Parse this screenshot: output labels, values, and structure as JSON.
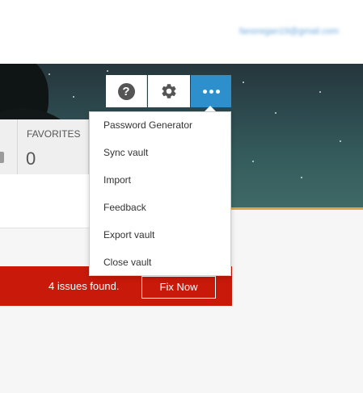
{
  "header": {
    "account_email": "fanoregan19@gmail.com"
  },
  "toolbar": {
    "help_icon": "question-circle-icon",
    "settings_icon": "gear-icon",
    "more_icon": "ellipsis-icon",
    "more_active_color": "#2e8fcd"
  },
  "menu": {
    "items": [
      {
        "label": "Password Generator"
      },
      {
        "label": "Sync vault"
      },
      {
        "label": "Import"
      },
      {
        "label": "Feedback"
      },
      {
        "label": "Export vault"
      },
      {
        "label": "Close vault"
      }
    ]
  },
  "stats": {
    "favorites_label": "FAVORITES",
    "favorites_value": "0"
  },
  "alert": {
    "text": "4 issues found.",
    "button_label": "Fix Now",
    "color": "#c8190a"
  }
}
